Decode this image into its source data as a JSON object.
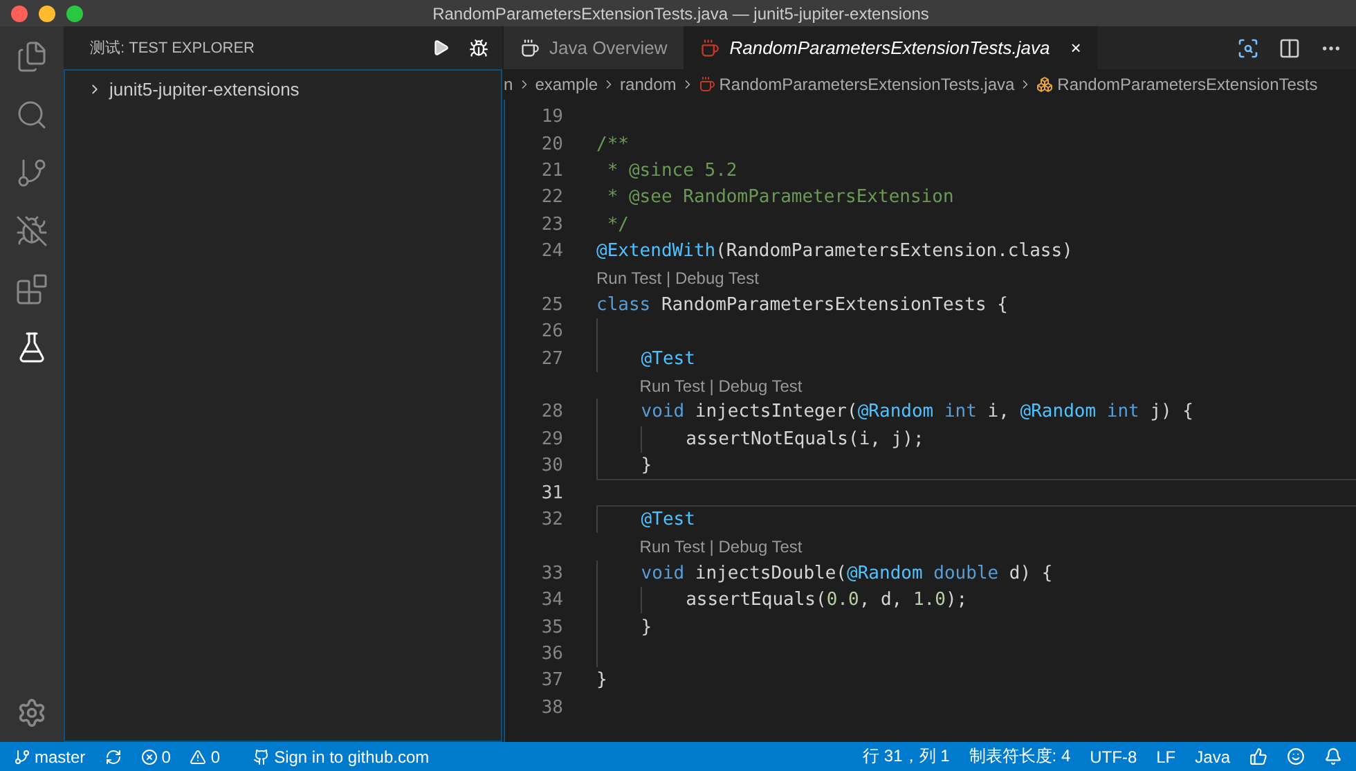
{
  "window": {
    "title": "RandomParametersExtensionTests.java — junit5-jupiter-extensions"
  },
  "activity_bar": [
    {
      "kind": "files",
      "selected": false
    },
    {
      "kind": "search",
      "selected": false
    },
    {
      "kind": "source-control",
      "selected": false
    },
    {
      "kind": "debug",
      "selected": false
    },
    {
      "kind": "extensions",
      "selected": false
    },
    {
      "kind": "test",
      "selected": true
    }
  ],
  "sidebar": {
    "title": "测试: TEST EXPLORER",
    "tree": [
      {
        "label": "junit5-jupiter-extensions",
        "expanded": false
      }
    ]
  },
  "tabs": [
    {
      "label": "Java Overview",
      "kind": "overview",
      "selected": false
    },
    {
      "label": "RandomParametersExtensionTests.java",
      "kind": "java",
      "selected": true,
      "close": "×"
    }
  ],
  "breadcrumbs": [
    {
      "label": "n",
      "kind": "folder"
    },
    {
      "label": "example",
      "kind": "folder"
    },
    {
      "label": "random",
      "kind": "folder"
    },
    {
      "label": "RandomParametersExtensionTests.java",
      "kind": "java"
    },
    {
      "label": "RandomParametersExtensionTests",
      "kind": "class"
    }
  ],
  "editor": {
    "lines": [
      {
        "kind": "code",
        "number": "19",
        "current": false
      },
      {
        "kind": "code",
        "number": "20",
        "current": false,
        "tokens": [
          {
            "kind": "comment",
            "text": "/**"
          }
        ]
      },
      {
        "kind": "code",
        "number": "21",
        "current": false,
        "tokens": [
          {
            "kind": "comment",
            "text": " * "
          },
          {
            "kind": "doctag",
            "text": "@since"
          },
          {
            "kind": "comment",
            "text": " 5.2"
          }
        ]
      },
      {
        "kind": "code",
        "number": "22",
        "current": false,
        "tokens": [
          {
            "kind": "comment",
            "text": " * "
          },
          {
            "kind": "doctag",
            "text": "@see"
          },
          {
            "kind": "comment",
            "text": " RandomParametersExtension"
          }
        ]
      },
      {
        "kind": "code",
        "number": "23",
        "current": false,
        "tokens": [
          {
            "kind": "comment",
            "text": " */"
          }
        ]
      },
      {
        "kind": "code",
        "number": "24",
        "current": false,
        "tokens": [
          {
            "kind": "annotation",
            "text": "@ExtendWith"
          },
          {
            "kind": "plain",
            "text": "(RandomParametersExtension.class)"
          }
        ]
      },
      {
        "kind": "codelens",
        "actions": [
          "Run Test",
          "Debug Test"
        ],
        "separator": "|"
      },
      {
        "kind": "code",
        "number": "25",
        "current": false,
        "tokens": [
          {
            "kind": "keyword",
            "text": "class"
          },
          {
            "kind": "plain",
            "text": " RandomParametersExtensionTests {"
          }
        ],
        "children": [
          {
            "kind": "code",
            "number": "26",
            "current": false
          },
          {
            "kind": "code",
            "number": "27",
            "current": false,
            "tokens": [
              {
                "kind": "annotation",
                "text": "@Test"
              }
            ]
          },
          {
            "kind": "codelens",
            "actions": [
              "Run Test",
              "Debug Test"
            ],
            "separator": "|"
          },
          {
            "kind": "code",
            "number": "28",
            "current": false,
            "tokens": [
              {
                "kind": "keyword",
                "text": "void"
              },
              {
                "kind": "plain",
                "text": " injectsInteger("
              },
              {
                "kind": "annotation",
                "text": "@Random"
              },
              {
                "kind": "keyword",
                "text": " int"
              },
              {
                "kind": "plain",
                "text": " i, "
              },
              {
                "kind": "annotation",
                "text": "@Random"
              },
              {
                "kind": "keyword",
                "text": " int"
              },
              {
                "kind": "plain",
                "text": " j) {"
              }
            ],
            "children": [
              {
                "kind": "code",
                "number": "29",
                "current": false,
                "tokens": [
                  {
                    "kind": "plain",
                    "text": "assertNotEquals(i, j);"
                  }
                ]
              }
            ]
          },
          {
            "kind": "code",
            "number": "30",
            "current": false,
            "tokens": [
              {
                "kind": "plain",
                "text": "}"
              }
            ]
          },
          {
            "kind": "code",
            "number": "31",
            "current": true
          },
          {
            "kind": "code",
            "number": "32",
            "current": false,
            "tokens": [
              {
                "kind": "annotation",
                "text": "@Test"
              }
            ]
          },
          {
            "kind": "codelens",
            "actions": [
              "Run Test",
              "Debug Test"
            ],
            "separator": "|"
          },
          {
            "kind": "code",
            "number": "33",
            "current": false,
            "tokens": [
              {
                "kind": "keyword",
                "text": "void"
              },
              {
                "kind": "plain",
                "text": " injectsDouble("
              },
              {
                "kind": "annotation",
                "text": "@Random"
              },
              {
                "kind": "keyword",
                "text": " double"
              },
              {
                "kind": "plain",
                "text": " d) {"
              }
            ],
            "children": [
              {
                "kind": "code",
                "number": "34",
                "current": false,
                "tokens": [
                  {
                    "kind": "plain",
                    "text": "assertEquals("
                  },
                  {
                    "kind": "number",
                    "text": "0.0"
                  },
                  {
                    "kind": "plain",
                    "text": ", d, "
                  },
                  {
                    "kind": "number",
                    "text": "1.0"
                  },
                  {
                    "kind": "plain",
                    "text": ");"
                  }
                ]
              }
            ]
          },
          {
            "kind": "code",
            "number": "35",
            "current": false,
            "tokens": [
              {
                "kind": "plain",
                "text": "}"
              }
            ]
          },
          {
            "kind": "code",
            "number": "36",
            "current": false
          }
        ]
      },
      {
        "kind": "code",
        "number": "37",
        "current": false,
        "tokens": [
          {
            "kind": "plain",
            "text": "}"
          }
        ]
      },
      {
        "kind": "code",
        "number": "38",
        "current": false
      }
    ]
  },
  "status_bar": {
    "left": [
      {
        "kind": "branch",
        "label": "master"
      },
      {
        "kind": "sync"
      },
      {
        "kind": "errors",
        "label": "0"
      },
      {
        "kind": "warnings",
        "label": "0"
      },
      {
        "kind": "github",
        "label": "Sign in to github.com"
      }
    ],
    "right": [
      {
        "kind": "text",
        "label": "行 31，列 1"
      },
      {
        "kind": "text",
        "label": "制表符长度: 4"
      },
      {
        "kind": "text",
        "label": "UTF-8"
      },
      {
        "kind": "text",
        "label": "LF"
      },
      {
        "kind": "text",
        "label": "Java"
      },
      {
        "kind": "tweet"
      },
      {
        "kind": "feedback"
      },
      {
        "kind": "bell"
      }
    ]
  }
}
